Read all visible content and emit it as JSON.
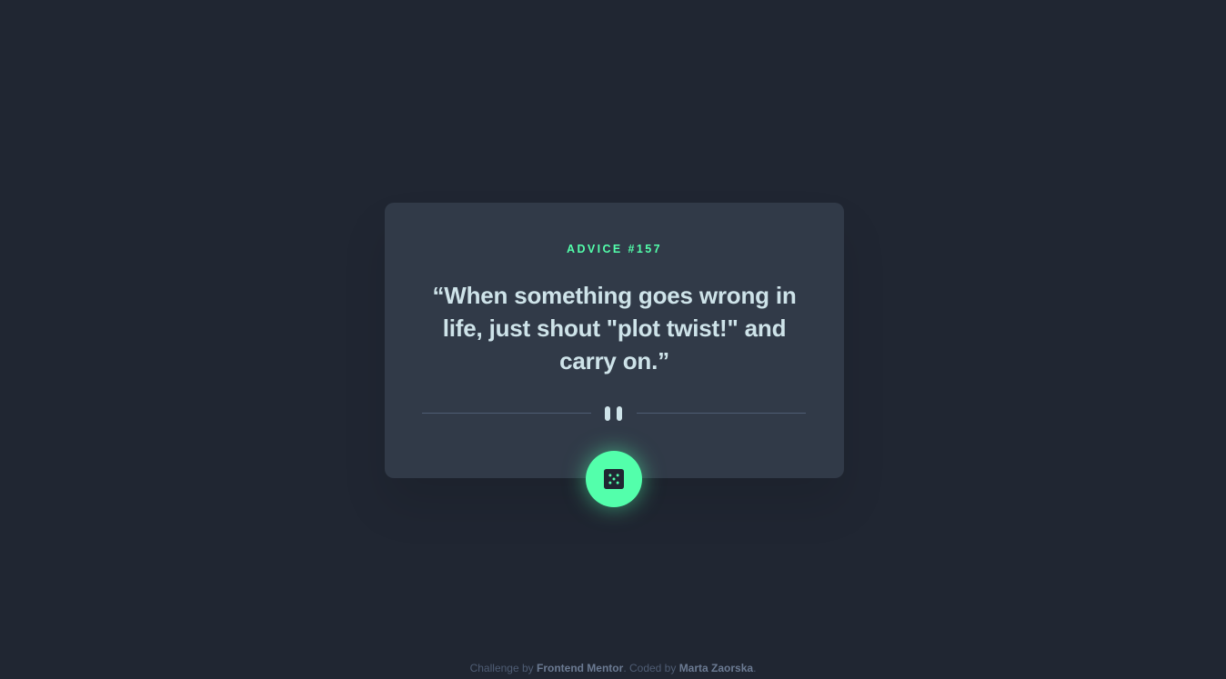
{
  "advice": {
    "label": "ADVICE #157",
    "quote": "“When something goes wrong in life, just shout \"plot twist!\" and carry on.”"
  },
  "divider": {
    "icon": "pause-icon"
  },
  "button": {
    "icon": "dice-icon"
  },
  "footer": {
    "prefix": "Challenge by ",
    "challenge_link": "Frontend Mentor",
    "middle": ". Coded by ",
    "author_link": "Marta Zaorska",
    "suffix": "."
  },
  "colors": {
    "background": "#202632",
    "card": "#313a48",
    "accent": "#53ffab",
    "text": "#cee3e9",
    "muted": "#4f5d74"
  }
}
